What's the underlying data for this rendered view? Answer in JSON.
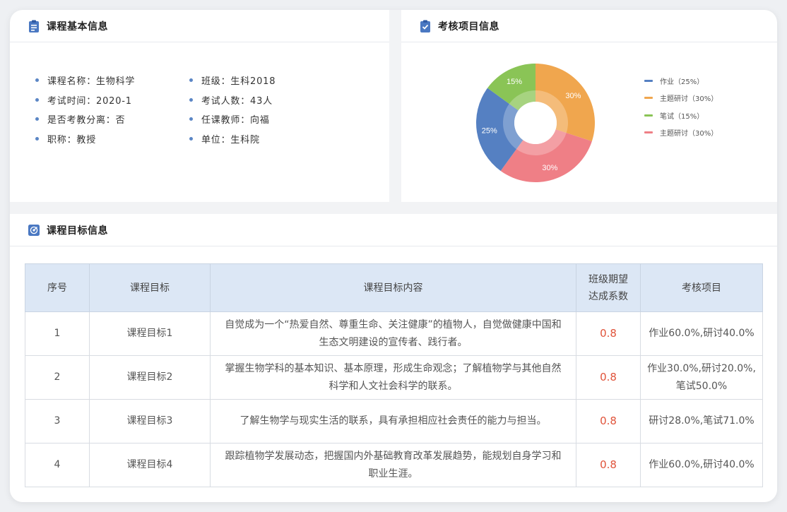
{
  "basic": {
    "title": "课程基本信息",
    "left_items": [
      "课程名称：生物科学",
      "考试时间：2020-1",
      "是否考教分离：否",
      "职称：教授"
    ],
    "right_items": [
      "班级：生科2018",
      "考试人数：43人",
      "任课教师：向福",
      "单位：生科院"
    ]
  },
  "assess": {
    "title": "考核项目信息",
    "chart_data": {
      "type": "pie",
      "style": "donut",
      "slices": [
        {
          "label": "作业（25%）",
          "value": 25,
          "text": "25%",
          "color": "#5580c2"
        },
        {
          "label": "主题研讨（30%）",
          "value": 30,
          "text": "30%",
          "color": "#f0a64e"
        },
        {
          "label": "笔试（15%）",
          "value": 15,
          "text": "15%",
          "color": "#8ac456"
        },
        {
          "label": "主题研讨（30%）",
          "value": 30,
          "text": "30%",
          "color": "#ef7f86"
        }
      ],
      "legend_position": "right"
    }
  },
  "goals": {
    "title": "课程目标信息",
    "columns": [
      "序号",
      "课程目标",
      "课程目标内容",
      "班级期望\n达成系数",
      "考核项目"
    ],
    "rows": [
      {
        "no": "1",
        "goal": "课程目标1",
        "content": "自觉成为一个“热爱自然、尊重生命、关注健康”的植物人，自觉做健康中国和生态文明建设的宣传者、践行者。",
        "coef": "0.8",
        "items": "作业60.0%,研讨40.0%"
      },
      {
        "no": "2",
        "goal": "课程目标2",
        "content": "掌握生物学科的基本知识、基本原理，形成生命观念；了解植物学与其他自然科学和人文社会科学的联系。",
        "coef": "0.8",
        "items": "作业30.0%,研讨20.0%,笔试50.0%"
      },
      {
        "no": "3",
        "goal": "课程目标3",
        "content": "了解生物学与现实生活的联系，具有承担相应社会责任的能力与担当。",
        "coef": "0.8",
        "items": "研讨28.0%,笔试71.0%"
      },
      {
        "no": "4",
        "goal": "课程目标4",
        "content": "跟踪植物学发展动态，把握国内外基础教育改革发展趋势，能规划自身学习和职业生涯。",
        "coef": "0.8",
        "items": "作业60.0%,研讨40.0%"
      }
    ]
  },
  "colors": {
    "accent": "#4a78c2",
    "coef": "#e0533a",
    "header_bg": "#dce7f5"
  }
}
